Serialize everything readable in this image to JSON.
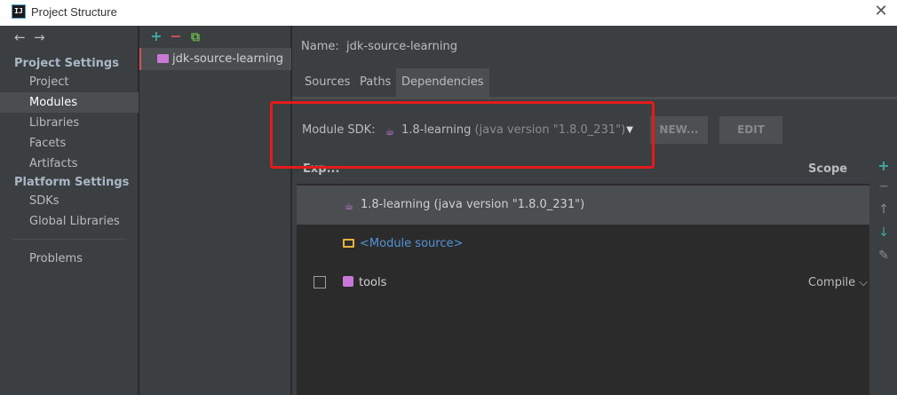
{
  "window": {
    "title": "Project Structure",
    "app_icon_text": "IJ"
  },
  "nav": {
    "back_icon": "←",
    "forward_icon": "→",
    "sections": [
      {
        "title": "Project Settings"
      },
      {
        "title": "Platform Settings"
      }
    ],
    "items": [
      {
        "label": "Project"
      },
      {
        "label": "Modules"
      },
      {
        "label": "Libraries"
      },
      {
        "label": "Facets"
      },
      {
        "label": "Artifacts"
      },
      {
        "label": "SDKs"
      },
      {
        "label": "Global Libraries"
      },
      {
        "label": "Problems"
      }
    ],
    "selected": "Modules"
  },
  "modules": {
    "toolbar": {
      "add": "+",
      "remove": "−",
      "copy": "⧉"
    },
    "list": [
      {
        "label": "jdk-source-learning"
      }
    ]
  },
  "editor": {
    "name_label": "Name:",
    "name_value": "jdk-source-learning",
    "tabs": [
      {
        "label": "Sources"
      },
      {
        "label": "Paths"
      },
      {
        "label": "Dependencies"
      }
    ],
    "active_tab": "Dependencies",
    "sdk_label": "Module SDK:",
    "sdk_value": "1.8-learning",
    "sdk_detail": "(java version \"1.8.0_231\")",
    "new_button": "NEW...",
    "edit_button": "EDIT",
    "table": {
      "col_export": "Exp...",
      "col_scope": "Scope",
      "rows": [
        {
          "label": "1.8-learning (java version \"1.8.0_231\")",
          "scope": ""
        },
        {
          "label": "<Module source>",
          "scope": ""
        },
        {
          "label": "tools",
          "scope": "Compile ⌵"
        }
      ]
    },
    "side_toolbar": {
      "add": "+",
      "remove": "−",
      "up": "↑",
      "down": "↓",
      "edit": "✎"
    }
  },
  "colors": {
    "highlight": "#e31b1b",
    "accent": "#3fa8a0",
    "link": "#5393d5"
  }
}
